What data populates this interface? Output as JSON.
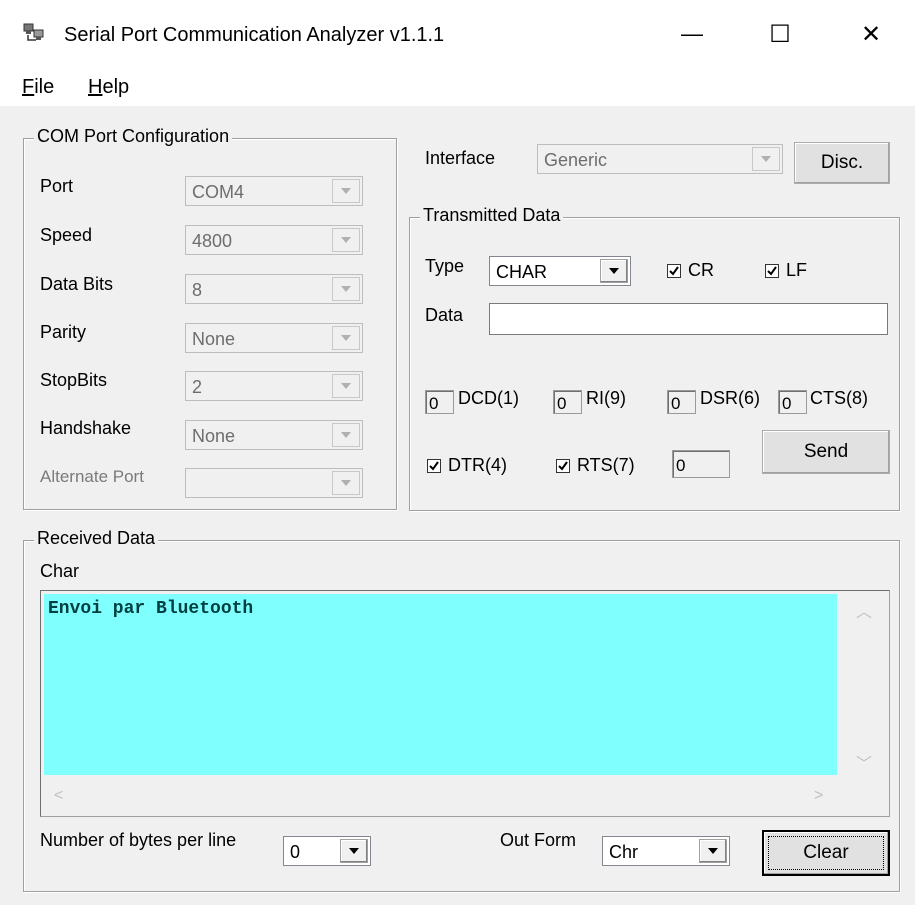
{
  "window": {
    "title": "Serial Port Communication Analyzer v1.1.1",
    "minimize_glyph": "—",
    "maximize_glyph": "☐",
    "close_glyph": "✕"
  },
  "menu": {
    "file": "File",
    "help": "Help"
  },
  "com_config": {
    "legend": "COM Port Configuration",
    "port_label": "Port",
    "port_value": "COM4",
    "speed_label": "Speed",
    "speed_value": "4800",
    "databits_label": "Data Bits",
    "databits_value": "8",
    "parity_label": "Parity",
    "parity_value": "None",
    "stopbits_label": "StopBits",
    "stopbits_value": "2",
    "handshake_label": "Handshake",
    "handshake_value": "None",
    "alternate_label": "Alternate Port",
    "alternate_value": ""
  },
  "interface": {
    "label": "Interface",
    "value": "Generic",
    "disc_button": "Disc."
  },
  "transmitted": {
    "legend": "Transmitted Data",
    "type_label": "Type",
    "type_value": "CHAR",
    "cr_label": "CR",
    "lf_label": "LF",
    "data_label": "Data",
    "data_value": "",
    "dcd_value": "0",
    "dcd_label": "DCD(1)",
    "ri_value": "0",
    "ri_label": "RI(9)",
    "dsr_value": "0",
    "dsr_label": "DSR(6)",
    "cts_value": "0",
    "cts_label": "CTS(8)",
    "dtr_label": "DTR(4)",
    "rts_label": "RTS(7)",
    "count_value": "0",
    "send_button": "Send"
  },
  "received": {
    "legend": "Received Data",
    "mode_label": "Char",
    "text": "Envoi par Bluetooth",
    "bytes_label": "Number of bytes per line",
    "bytes_value": "0",
    "outform_label": "Out Form",
    "outform_value": "Chr",
    "clear_button": "Clear"
  },
  "colors": {
    "received_background": "#80ffff",
    "window_background": "#f0f0f0"
  }
}
